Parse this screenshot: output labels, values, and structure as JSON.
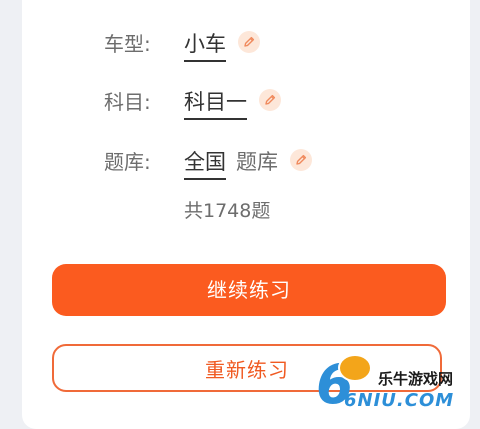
{
  "settings": {
    "rows": [
      {
        "label": "车型:",
        "value": "小车"
      },
      {
        "label": "科目:",
        "value": "科目一"
      },
      {
        "label": "题库:",
        "value": "全国",
        "suffix": "题库"
      }
    ],
    "question_count": "共1748题"
  },
  "actions": {
    "continue_label": "继续练习",
    "restart_label": "重新练习"
  },
  "watermark": {
    "brand": "乐牛游戏网",
    "domain": "6NIU.COM",
    "six": "6"
  },
  "colors": {
    "accent": "#fb5b1f",
    "accent_outline": "#f06a39",
    "edit_badge_bg": "#fde7d9"
  },
  "icons": {
    "edit": "pencil-icon"
  }
}
